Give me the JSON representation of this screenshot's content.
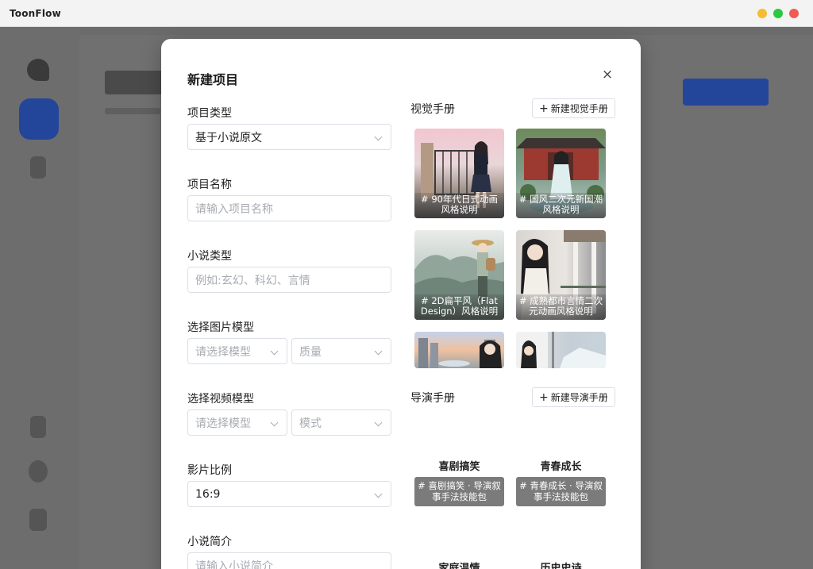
{
  "window": {
    "title": "ToonFlow",
    "controls": [
      {
        "name": "minimize",
        "color": "#f5bd2f"
      },
      {
        "name": "maximize",
        "color": "#29c940"
      },
      {
        "name": "close",
        "color": "#f15a52"
      }
    ]
  },
  "modal": {
    "title": "新建项目",
    "close_icon": "×",
    "fields": {
      "project_type": {
        "label": "项目类型",
        "value": "基于小说原文"
      },
      "project_name": {
        "label": "项目名称",
        "placeholder": "请输入项目名称"
      },
      "novel_type": {
        "label": "小说类型",
        "placeholder": "例如:玄幻、科幻、言情"
      },
      "image_model": {
        "label": "选择图片模型",
        "model_placeholder": "请选择模型",
        "quality_placeholder": "质量"
      },
      "video_model": {
        "label": "选择视频模型",
        "model_placeholder": "请选择模型",
        "mode_placeholder": "模式"
      },
      "aspect_ratio": {
        "label": "影片比例",
        "value": "16:9"
      },
      "synopsis": {
        "label": "小说简介",
        "placeholder": "请输入小说简介"
      }
    },
    "visual_manual": {
      "label": "视觉手册",
      "new_button": "新建视觉手册",
      "cards": [
        {
          "caption": "# 90年代日式动画风格说明"
        },
        {
          "caption": "# 国风二次元新国潮风格说明"
        },
        {
          "caption": "# 2D扁平风（Flat Design）风格说明"
        },
        {
          "caption": "# 成熟都市言情二次元动画风格说明"
        },
        {
          "caption": ""
        },
        {
          "caption": ""
        }
      ]
    },
    "director_manual": {
      "label": "导演手册",
      "new_button": "新建导演手册",
      "items": [
        {
          "title": "喜剧搞笑",
          "caption": "# 喜剧搞笑 · 导演叙事手法技能包"
        },
        {
          "title": "青春成长",
          "caption": "# 青春成长 · 导演叙事手法技能包"
        },
        {
          "title": "家庭温情",
          "caption": ""
        },
        {
          "title": "历史史诗",
          "caption": ""
        }
      ]
    }
  },
  "icons": {
    "close": "close-icon",
    "chevron": "chevron-down-icon",
    "plus": "plus-icon"
  }
}
